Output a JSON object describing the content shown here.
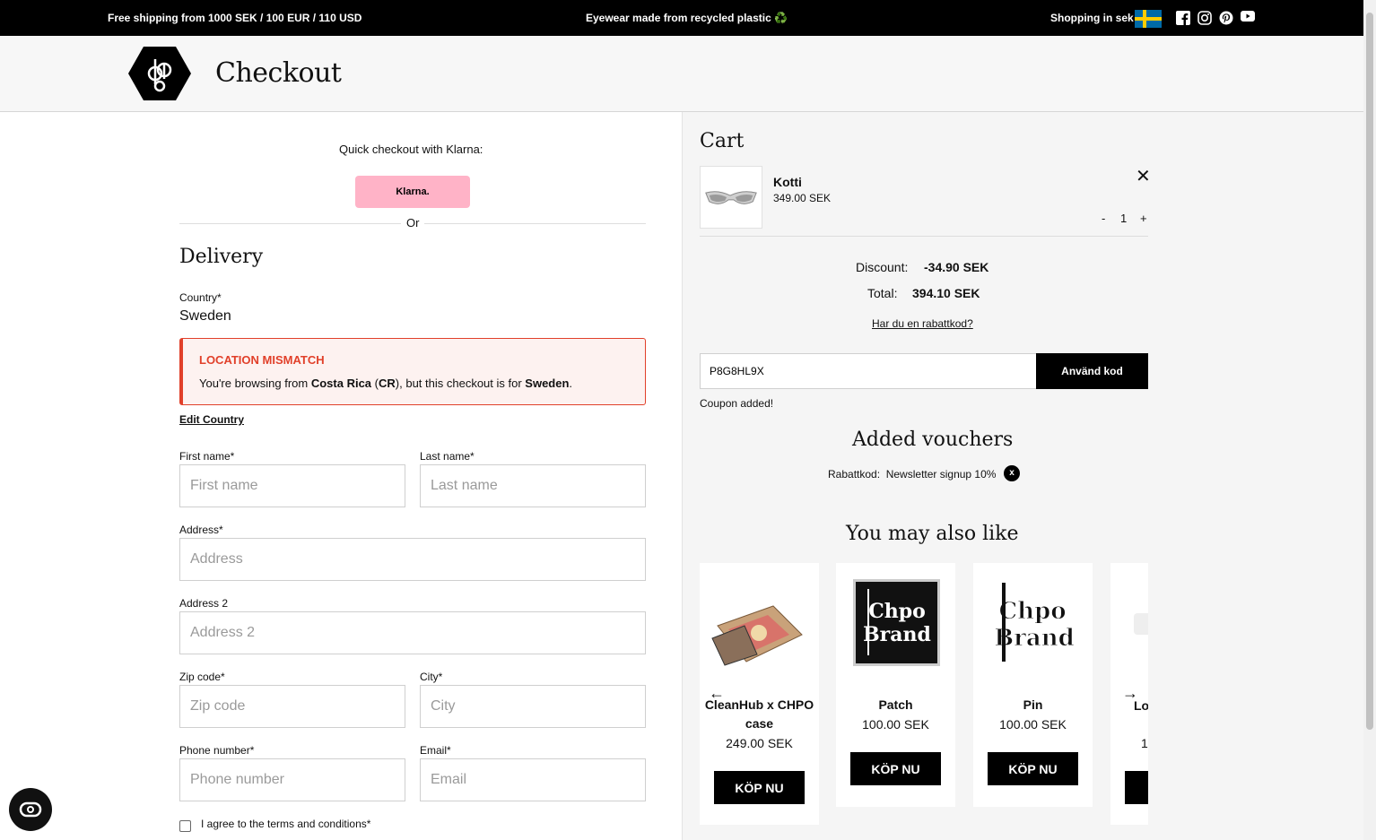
{
  "topbar": {
    "shipping": "Free shipping from 1000 SEK / 100 EUR / 110 USD",
    "eyewear": "Eyewear made from recycled plastic ♻️",
    "shopping": "Shopping in sek",
    "social_icons": [
      "facebook-icon",
      "instagram-icon",
      "pinterest-icon",
      "youtube-icon"
    ]
  },
  "header": {
    "title": "Checkout",
    "logo_icon": "chpo-logo"
  },
  "klarna": {
    "quick": "Quick checkout with Klarna:",
    "button": "Klarna.",
    "or": "Or"
  },
  "delivery": {
    "title": "Delivery",
    "country_label": "Country*",
    "country_value": "Sweden",
    "warning": {
      "title": "LOCATION MISMATCH",
      "pre": "You're browsing from ",
      "location": "Costa Rica",
      "open": " (",
      "code": "CR",
      "mid": "), but this checkout is for ",
      "target": "Sweden",
      "end": "."
    },
    "edit_country": "Edit Country",
    "first_name": {
      "label": "First name*",
      "placeholder": "First name"
    },
    "last_name": {
      "label": "Last name*",
      "placeholder": "Last name"
    },
    "address": {
      "label": "Address*",
      "placeholder": "Address"
    },
    "address2": {
      "label": "Address 2",
      "placeholder": "Address 2"
    },
    "zip": {
      "label": "Zip code*",
      "placeholder": "Zip code"
    },
    "city": {
      "label": "City*",
      "placeholder": "City"
    },
    "phone": {
      "label": "Phone number*",
      "placeholder": "Phone number"
    },
    "email": {
      "label": "Email*",
      "placeholder": "Email"
    },
    "terms": "I agree to the terms and conditions*"
  },
  "cart": {
    "title": "Cart",
    "item": {
      "name": "Kotti",
      "price": "349.00 SEK",
      "qty": "1",
      "minus": "-",
      "plus": "+",
      "remove": "✕"
    },
    "discount_label": "Discount:",
    "discount_value": "-34.90 SEK",
    "total_label": "Total:",
    "total_value": "394.10 SEK",
    "rabatt_link": "Har du en rabattkod?",
    "coupon_value": "P8G8HL9X",
    "coupon_button": "Använd kod",
    "coupon_msg": "Coupon added!",
    "vouchers_title": "Added vouchers",
    "voucher_label": "Rabattkod:",
    "voucher_value": "Newsletter signup 10%",
    "voucher_remove": "x",
    "also_like": "You may also like",
    "arrow_left": "←",
    "arrow_right": "→",
    "products": [
      {
        "name": "CleanHub x CHPO case",
        "price": "249.00 SEK",
        "button": "KÖP NU"
      },
      {
        "name": "Patch",
        "price": "100.00 SEK",
        "button": "KÖP NU"
      },
      {
        "name": "Pin",
        "price": "100.00 SEK",
        "button": "KÖP NU"
      },
      {
        "name": "Lo",
        "price": "1(",
        "button": ""
      }
    ]
  },
  "colors": {
    "warning": "#e1402a",
    "klarna": "#ffb3c7",
    "flag_blue": "#006aa7",
    "flag_yellow": "#fecc00"
  }
}
